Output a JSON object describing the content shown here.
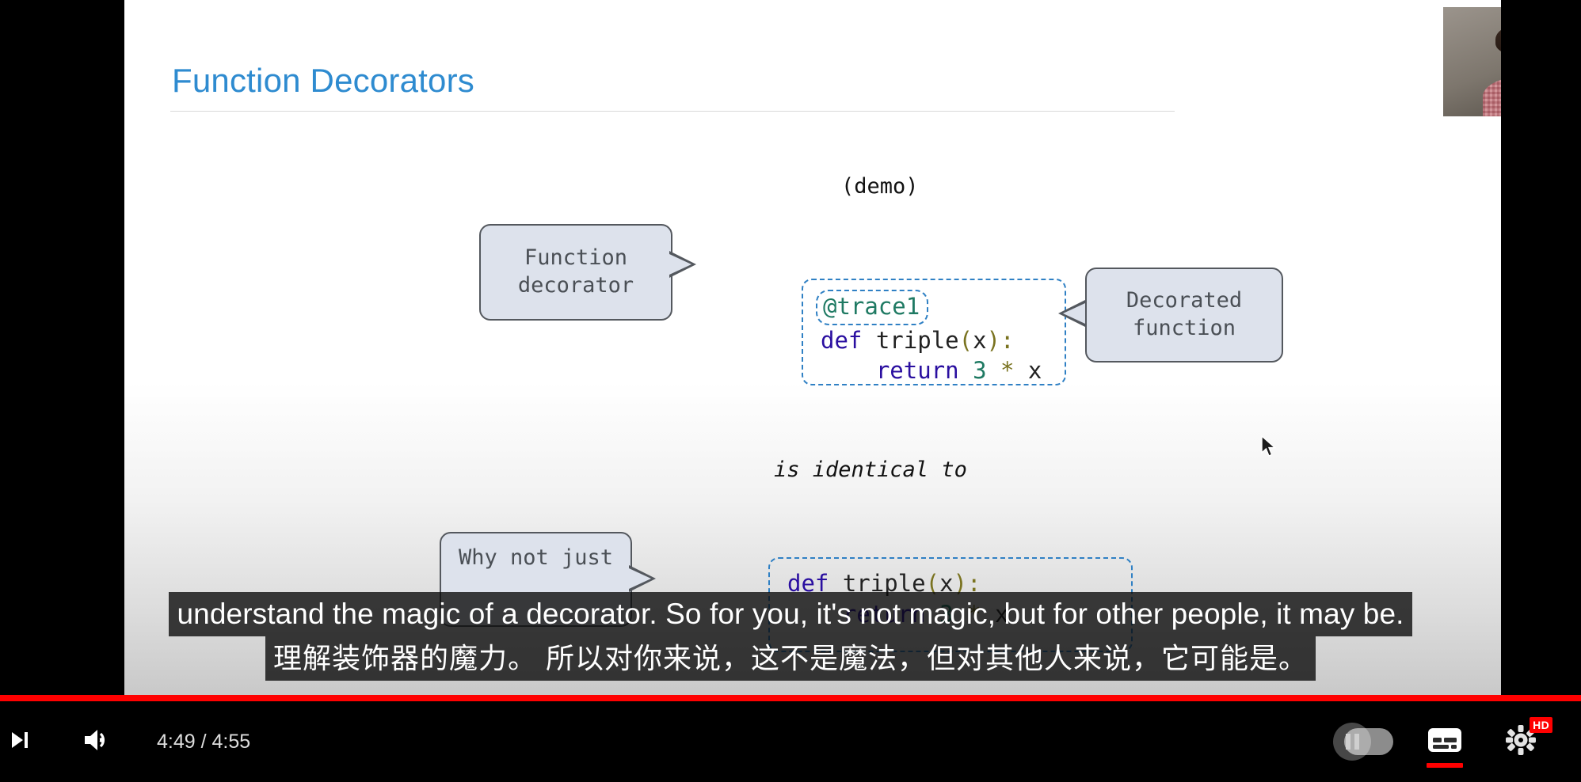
{
  "slide": {
    "title": "Function Decorators",
    "demo_label": "(demo)",
    "identical_label": "is identical to",
    "callouts": {
      "function_decorator": "Function\ndecorator",
      "decorated_function": "Decorated\nfunction",
      "why_not_just": "Why not just"
    },
    "code_top": {
      "decorator_line": "@trace1",
      "def_keyword": "def",
      "def_name": " triple",
      "def_open": "(",
      "def_arg": "x",
      "def_close": ")",
      "def_colon": ":",
      "indent": "    ",
      "return_keyword": "return",
      "return_num": " 3",
      "return_op": " *",
      "return_var": " x"
    },
    "code_bottom": {
      "def_keyword": "def",
      "def_name": " triple",
      "def_open": "(",
      "def_arg": "x",
      "def_close": ")",
      "def_colon": ":",
      "indent": "    ",
      "return_keyword": "return",
      "return_num": " 3",
      "return_op": " *",
      "return_var": " x"
    },
    "accent_color": "#2e8bd0",
    "callout_fill": "#dde2ec",
    "callout_border": "#54585e",
    "code_border": "#2f80c4"
  },
  "subtitles": {
    "primary": "understand the magic of a decorator. So for you, it's not magic, but for other people, it may be.",
    "secondary": "理解装饰器的魔力。 所以对你来说，这不是魔法，但对其他人来说，它可能是。"
  },
  "player": {
    "current_time": "4:49",
    "total_time": "4:55",
    "time_display": "4:49 / 4:55",
    "progress_percent": 100,
    "progress_color": "#ff0000",
    "quality_badge": "HD",
    "captions_active": true,
    "controls": {
      "next": "next-video",
      "volume": "volume",
      "autoplay": "autoplay-toggle",
      "captions": "subtitles-closed-captions",
      "settings": "settings"
    }
  },
  "webcam": {
    "label": "presenter-webcam"
  }
}
